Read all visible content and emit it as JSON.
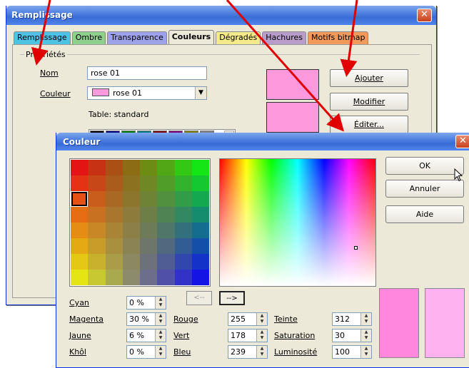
{
  "back_dialog": {
    "title": "Remplissage",
    "tabs": [
      {
        "label": "Remplissage",
        "color": "#4fc3e6"
      },
      {
        "label": "Ombre",
        "color": "#8fd08f"
      },
      {
        "label": "Transparence",
        "color": "#9ea2ea"
      },
      {
        "label": "Couleurs",
        "color": "#ece9d8"
      },
      {
        "label": "Dégradés",
        "color": "#f4ea8a"
      },
      {
        "label": "Hachures",
        "color": "#b89cc9"
      },
      {
        "label": "Motifs bitmap",
        "color": "#f29a5c"
      }
    ],
    "group_label": "Propriétés",
    "nom_label": "Nom",
    "nom_value": "rose 01",
    "couleur_label": "Couleur",
    "couleur_value": "rose 01",
    "table_label": "Table: standard",
    "buttons": {
      "ajouter": "Ajouter",
      "modifier": "Modifier",
      "editer": "Éditer..."
    },
    "palette_colors": [
      "#000000",
      "#000080",
      "#008000",
      "#008080",
      "#800000",
      "#800080",
      "#808000",
      "#808080"
    ]
  },
  "color_dialog": {
    "title": "Couleur",
    "buttons": {
      "ok": "OK",
      "annuler": "Annuler",
      "aide": "Aide"
    },
    "arrow_left": "<--",
    "arrow_right": "-->",
    "cmyk": [
      {
        "label": "Cyan",
        "value": "0 %"
      },
      {
        "label": "Magenta",
        "value": "30 %"
      },
      {
        "label": "Jaune",
        "value": "6 %"
      },
      {
        "label": "Khôl",
        "value": "0 %"
      }
    ],
    "rgb": [
      {
        "label": "Rouge",
        "value": "255"
      },
      {
        "label": "Vert",
        "value": "178"
      },
      {
        "label": "Bleu",
        "value": "239"
      }
    ],
    "hsl": [
      {
        "label": "Teinte",
        "value": "312"
      },
      {
        "label": "Saturation",
        "value": "30"
      },
      {
        "label": "Luminosité",
        "value": "100"
      }
    ],
    "current_color": "#ff88dd",
    "new_color": "#ffb2ef"
  },
  "accent": {
    "selected_pink": "#ff99dd",
    "arrow_red": "#e00000"
  }
}
